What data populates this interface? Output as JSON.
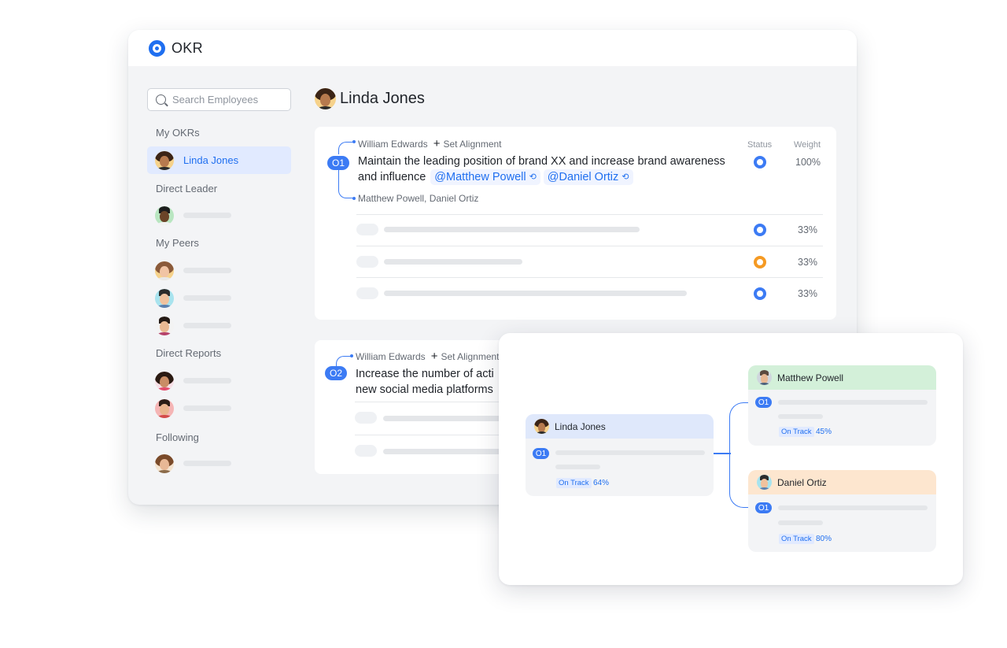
{
  "app": {
    "title": "OKR",
    "accent": "#1f6ff0"
  },
  "sidebar": {
    "search_placeholder": "Search Employees",
    "sections": {
      "my_okrs": "My OKRs",
      "direct_leader": "Direct Leader",
      "my_peers": "My Peers",
      "direct_reports": "Direct Reports",
      "following": "Following"
    },
    "active_user": "Linda Jones"
  },
  "main": {
    "profile_name": "Linda Jones",
    "columns": {
      "status": "Status",
      "weight": "Weight"
    },
    "objectives": [
      {
        "badge": "O1",
        "leader": "William Edwards",
        "set_alignment": "Set Alignment",
        "text": "Maintain the leading position of brand XX and increase brand awareness and influence",
        "mentions": [
          "Matthew Powell",
          "Daniel Ortiz"
        ],
        "aligned_by": "Matthew Powell, Daniel Ortiz",
        "weight": "100%",
        "status_color": "#3c7bf4",
        "key_results": [
          {
            "weight": "33%",
            "status_color": "#3c7bf4"
          },
          {
            "weight": "33%",
            "status_color": "#f59a23"
          },
          {
            "weight": "33%",
            "status_color": "#3c7bf4"
          }
        ]
      },
      {
        "badge": "O2",
        "leader": "William Edwards",
        "set_alignment": "Set Alignment",
        "text_line1": "Increase the number of acti",
        "text_line2": "new social media platforms"
      }
    ]
  },
  "alignment_view": {
    "owner": {
      "name": "Linda Jones",
      "badge": "O1",
      "status": "On Track",
      "progress": "64%"
    },
    "children": [
      {
        "name": "Matthew Powell",
        "badge": "O1",
        "status": "On Track",
        "progress": "45%",
        "header_color": "#d3f0d9"
      },
      {
        "name": "Daniel Ortiz",
        "badge": "O1",
        "status": "On Track",
        "progress": "80%",
        "header_color": "#fde6cf"
      }
    ]
  }
}
